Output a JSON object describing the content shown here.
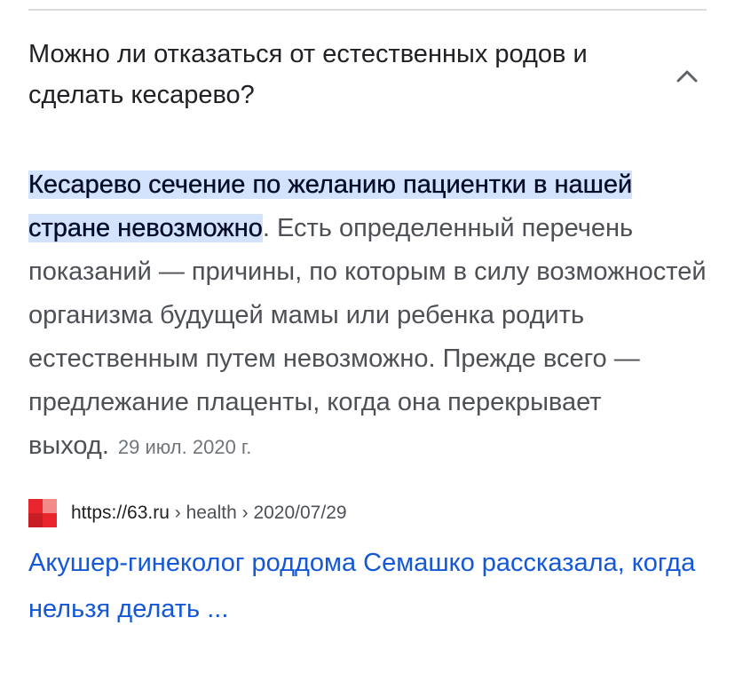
{
  "question": {
    "text": "Можно ли отказаться от естественных родов и сделать кесарево?",
    "toggle_icon": "chevron-up-icon"
  },
  "answer": {
    "highlight": "Кесарево сечение по желанию пациентки в нашей стране невозможно",
    "body": ". Есть определенный перечень показаний — причины, по которым в силу возможностей организма будущей мамы или ребенка родить естественным путем невозможно. Прежде всего — предлежание плаценты, когда она перекрывает выход.",
    "date": "29 июл. 2020 г."
  },
  "source": {
    "favicon_icon": "site-favicon-icon",
    "favicon_colors": [
      "#e8242c",
      "#f28a8a"
    ],
    "url": "https://63.ru",
    "breadcrumb": " › health › 2020/07/29"
  },
  "result": {
    "title": "Акушер-гинеколог роддома Семашко рассказала, когда нельзя делать ..."
  },
  "colors": {
    "highlight_bg": "#d3e3fd",
    "link": "#1558d6",
    "divider": "#dadce0"
  }
}
